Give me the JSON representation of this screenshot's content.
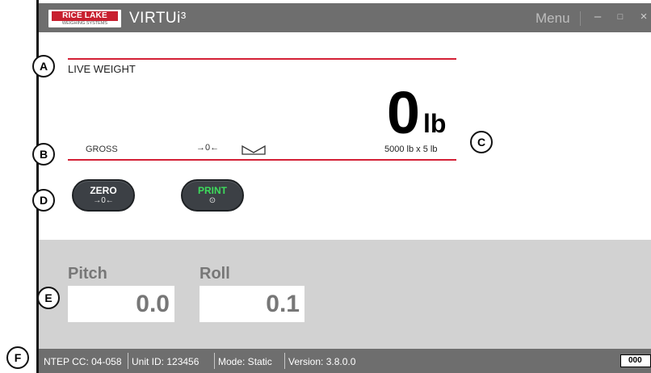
{
  "titlebar": {
    "logo_text": "RICE LAKE",
    "logo_subtext": "WEIGHING SYSTEMS",
    "app_name": "VIRTUi³",
    "menu_label": "Menu",
    "minimize_glyph": "–",
    "maximize_glyph": "□",
    "close_glyph": "×"
  },
  "weight_panel": {
    "live_label": "LIVE WEIGHT",
    "value": "0",
    "unit": "lb",
    "gross_label": "GROSS",
    "center_of_zero": "→0←",
    "capacity": "5000 lb x 5 lb",
    "motion_icon": "motion-icon",
    "accent_color": "#d42036"
  },
  "buttons": {
    "zero": {
      "label": "ZERO",
      "sub": "→0←",
      "label_color": "#ffffff"
    },
    "print": {
      "label": "PRINT",
      "sub": "⊙",
      "label_color": "#3ddc5c"
    }
  },
  "tilt": {
    "pitch_label": "Pitch",
    "pitch_value": "0.0",
    "roll_label": "Roll",
    "roll_value": "0.1"
  },
  "statusbar": {
    "ntep": "NTEP CC: 04-058",
    "unit_id": "Unit ID:  123456",
    "mode": "Mode: Static",
    "version": "Version:  3.8.0.0",
    "badge": "000"
  },
  "callouts": [
    "A",
    "B",
    "C",
    "D",
    "E",
    "F"
  ]
}
